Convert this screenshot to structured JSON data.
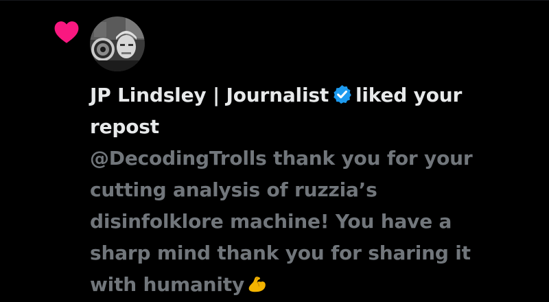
{
  "notification": {
    "type_icon": "heart-icon",
    "accent_color": "#f91880",
    "avatar_icon": "profile-photo",
    "actor_name": "JP Lindsley | Journalist",
    "verified_icon": "verified-badge-icon",
    "verified_color": "#1d9bf0",
    "action_text": "liked your repost",
    "post_text": "@DecodingTrolls thank you for your cutting analysis of ruzzia’s disinfolklore machine! You have a sharp mind thank you for sharing it with humanity",
    "post_emoji": "flexed-biceps-icon"
  }
}
